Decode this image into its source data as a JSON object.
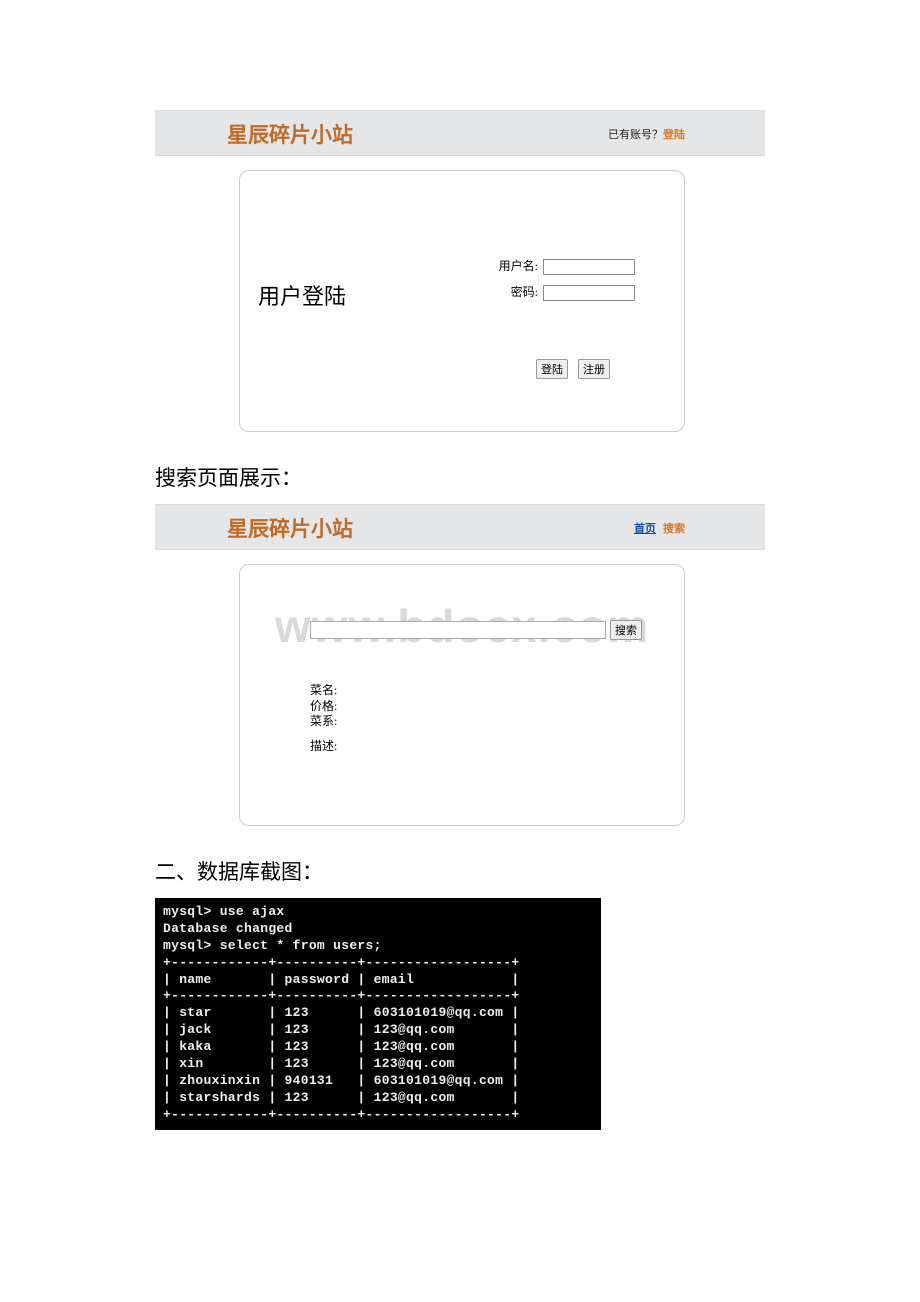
{
  "site_title": "星辰碎片小站",
  "banner1": {
    "prefix": "已有账号？",
    "login": "登陆"
  },
  "login_section": {
    "title": "用户登陆",
    "username_label": "用户名:",
    "password_label": "密码:",
    "login_btn": "登陆",
    "register_btn": "注册"
  },
  "search_heading": "搜索页面展示：",
  "banner2": {
    "home": "首页",
    "search": "搜索"
  },
  "search_section": {
    "search_btn": "搜索",
    "dish_name": "菜名:",
    "price": "价格:",
    "cuisine": "菜系:",
    "desc": "描述:"
  },
  "watermark": "www.bdocx.com",
  "db_heading": "二、数据库截图：",
  "terminal": {
    "line1": "mysql> use ajax",
    "line2": "Database changed",
    "line3": "mysql> select * from users;",
    "headers": [
      "name",
      "password",
      "email"
    ],
    "rows": [
      {
        "name": "star",
        "password": "123",
        "email": "603101019@qq.com"
      },
      {
        "name": "jack",
        "password": "123",
        "email": "123@qq.com"
      },
      {
        "name": "kaka",
        "password": "123",
        "email": "123@qq.com"
      },
      {
        "name": "xin",
        "password": "123",
        "email": "123@qq.com"
      },
      {
        "name": "zhouxinxin",
        "password": "940131",
        "email": "603101019@qq.com"
      },
      {
        "name": "starshards",
        "password": "123",
        "email": "123@qq.com"
      }
    ]
  }
}
